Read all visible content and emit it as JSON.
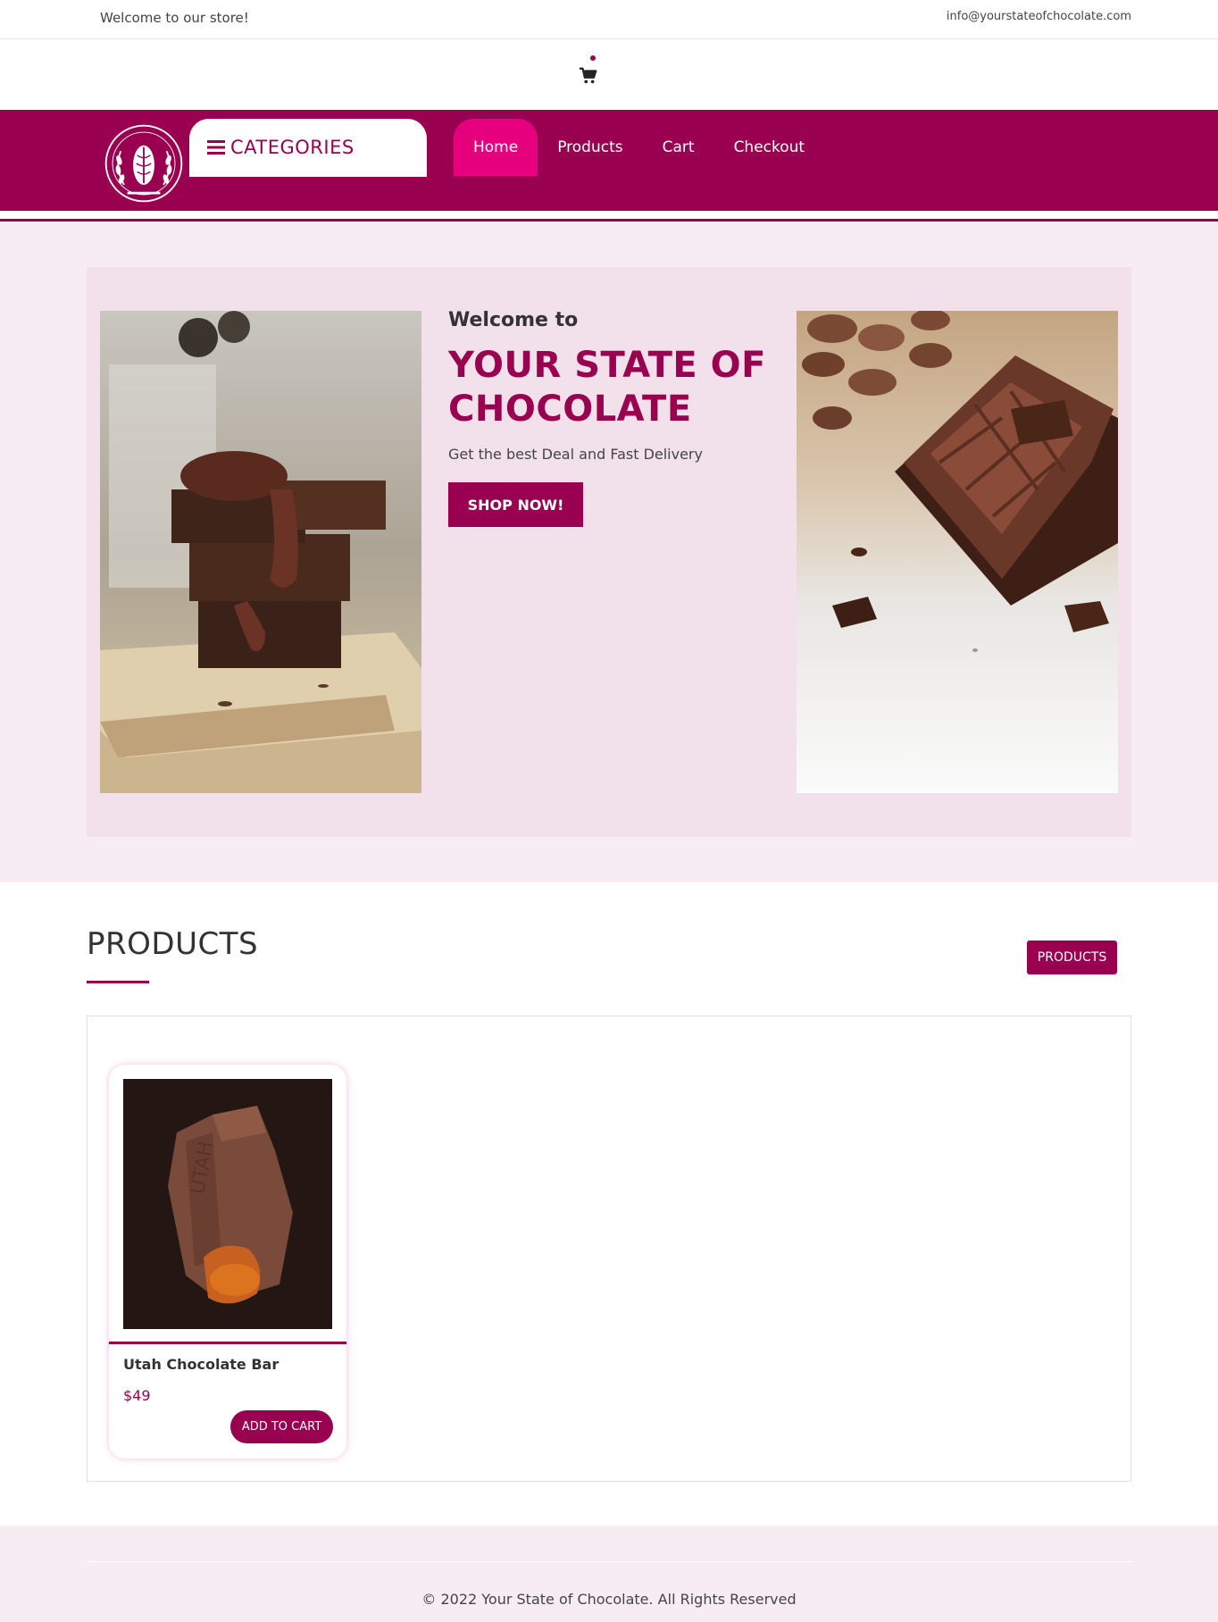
{
  "topbar": {
    "welcome": "Welcome to our store!",
    "email": "info@yourstateofchocolate.com"
  },
  "cart": {
    "icon": "shopping-cart-icon"
  },
  "nav": {
    "logo_text": "YOUR STATE OF CHOCOLATE",
    "categories_label": "CATEGORIES",
    "links": [
      {
        "label": "Home",
        "active": true
      },
      {
        "label": "Products",
        "active": false
      },
      {
        "label": "Cart",
        "active": false
      },
      {
        "label": "Checkout",
        "active": false
      }
    ]
  },
  "hero": {
    "welcome": "Welcome to",
    "title": "YOUR STATE OF CHOCOLATE",
    "subtitle": "Get the best Deal and Fast Delivery",
    "button": "SHOP NOW!"
  },
  "products": {
    "heading": "PRODUCTS",
    "button": "PRODUCTS",
    "items": [
      {
        "name": "Utah Chocolate Bar",
        "price": "$49",
        "button": "ADD TO CART"
      }
    ]
  },
  "footer": {
    "text": "© 2022 Your State of Chocolate. All Rights Reserved"
  },
  "colors": {
    "brand": "#990050",
    "accent": "#e6007e",
    "hero_bg": "#f2e1eb",
    "section_bg": "#f8ecf3"
  }
}
